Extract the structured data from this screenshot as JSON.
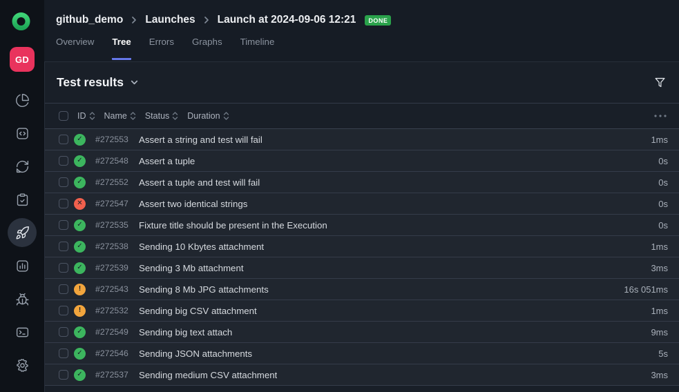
{
  "brand": {
    "logo_icon": "allure-logo",
    "avatar_initials": "GD"
  },
  "sidebar": {
    "items": [
      {
        "icon": "pie-chart-icon",
        "active": false
      },
      {
        "icon": "code-square-icon",
        "active": false
      },
      {
        "icon": "sync-icon",
        "active": false
      },
      {
        "icon": "clipboard-check-icon",
        "active": false
      },
      {
        "icon": "rocket-icon",
        "active": true
      },
      {
        "icon": "bar-chart-square-icon",
        "active": false
      },
      {
        "icon": "bug-icon",
        "active": false
      },
      {
        "icon": "terminal-icon",
        "active": false
      },
      {
        "icon": "settings-gear-icon",
        "active": false
      }
    ]
  },
  "header": {
    "breadcrumb": [
      "github_demo",
      "Launches",
      "Launch at 2024-09-06 12:21"
    ],
    "status_badge": "DONE",
    "tabs": [
      {
        "label": "Overview",
        "active": false
      },
      {
        "label": "Tree",
        "active": true
      },
      {
        "label": "Errors",
        "active": false
      },
      {
        "label": "Graphs",
        "active": false
      },
      {
        "label": "Timeline",
        "active": false
      }
    ]
  },
  "main": {
    "title": "Test results",
    "table": {
      "columns": [
        "ID",
        "Name",
        "Status",
        "Duration"
      ],
      "rows": [
        {
          "id": "#272553",
          "status": "passed",
          "name": "Assert a string and test will fail",
          "duration": "1ms"
        },
        {
          "id": "#272548",
          "status": "passed",
          "name": "Assert a tuple",
          "duration": "0s"
        },
        {
          "id": "#272552",
          "status": "passed",
          "name": "Assert a tuple and test will fail",
          "duration": "0s"
        },
        {
          "id": "#272547",
          "status": "failed",
          "name": "Assert two identical strings",
          "duration": "0s"
        },
        {
          "id": "#272535",
          "status": "passed",
          "name": "Fixture title should be present in the Execution",
          "duration": "0s"
        },
        {
          "id": "#272538",
          "status": "passed",
          "name": "Sending 10 Kbytes attachment",
          "duration": "1ms"
        },
        {
          "id": "#272539",
          "status": "passed",
          "name": "Sending 3 Mb attachment",
          "duration": "3ms"
        },
        {
          "id": "#272543",
          "status": "broken",
          "name": "Sending 8 Mb JPG attachments",
          "duration": "16s 051ms"
        },
        {
          "id": "#272532",
          "status": "broken",
          "name": "Sending big CSV attachment",
          "duration": "1ms"
        },
        {
          "id": "#272549",
          "status": "passed",
          "name": "Sending big text attach",
          "duration": "9ms"
        },
        {
          "id": "#272546",
          "status": "passed",
          "name": "Sending JSON attachments",
          "duration": "5s"
        },
        {
          "id": "#272537",
          "status": "passed",
          "name": "Sending medium CSV attachment",
          "duration": "3ms"
        }
      ]
    }
  },
  "status_icons": {
    "passed": {
      "glyph": "✓",
      "color": "#3cb55e"
    },
    "failed": {
      "glyph": "✕",
      "color": "#f1604d"
    },
    "broken": {
      "glyph": "!",
      "color": "#f2a53d"
    }
  },
  "colors": {
    "accent_tab_underline": "#6577e8",
    "badge_green": "#2aa24b",
    "avatar_pink": "#e9335d",
    "logo_green": "#2fbf63"
  }
}
